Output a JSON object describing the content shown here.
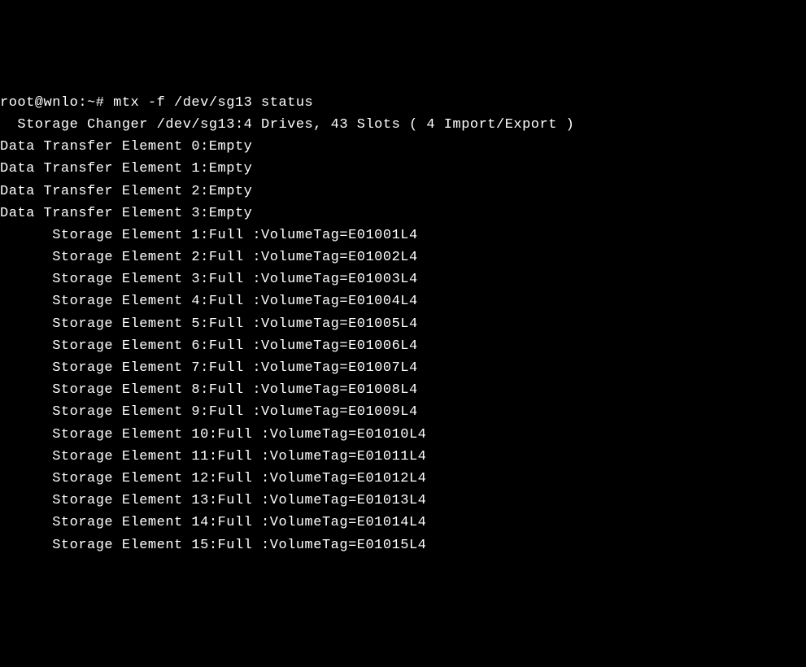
{
  "prompt_line": "root@wnlo:~# mtx -f /dev/sg13 status",
  "summary_line": "  Storage Changer /dev/sg13:4 Drives, 43 Slots ( 4 Import/Export )",
  "data_transfer_elements": [
    "Data Transfer Element 0:Empty",
    "Data Transfer Element 1:Empty",
    "Data Transfer Element 2:Empty",
    "Data Transfer Element 3:Empty"
  ],
  "storage_elements": [
    "      Storage Element 1:Full :VolumeTag=E01001L4",
    "      Storage Element 2:Full :VolumeTag=E01002L4",
    "      Storage Element 3:Full :VolumeTag=E01003L4",
    "      Storage Element 4:Full :VolumeTag=E01004L4",
    "      Storage Element 5:Full :VolumeTag=E01005L4",
    "      Storage Element 6:Full :VolumeTag=E01006L4",
    "      Storage Element 7:Full :VolumeTag=E01007L4",
    "      Storage Element 8:Full :VolumeTag=E01008L4",
    "      Storage Element 9:Full :VolumeTag=E01009L4",
    "      Storage Element 10:Full :VolumeTag=E01010L4",
    "      Storage Element 11:Full :VolumeTag=E01011L4",
    "      Storage Element 12:Full :VolumeTag=E01012L4",
    "      Storage Element 13:Full :VolumeTag=E01013L4",
    "      Storage Element 14:Full :VolumeTag=E01014L4",
    "      Storage Element 15:Full :VolumeTag=E01015L4"
  ]
}
